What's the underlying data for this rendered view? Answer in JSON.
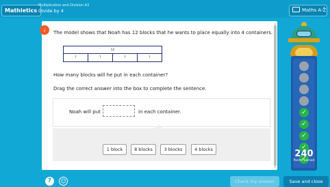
{
  "header": {
    "brand": "Mathletics",
    "crumb_line1": "Multiplication and Division A3",
    "crumb_line2": "Divide by 4",
    "atoz_label": "Maths A-Z",
    "atoz_external_icon": "external-link-icon"
  },
  "question": {
    "speaker_icon": "speaker-icon",
    "text": "The model shows that Noah has 12 blocks that he wants to place equally into 4 containers.",
    "bar_model": {
      "total": "12",
      "parts": [
        "?",
        "?",
        "?",
        "?"
      ]
    },
    "prompt": "How many blocks will he put in each container?",
    "instruction": "Drag the correct answer into the box to complete the sentence."
  },
  "sentence": {
    "before": "Noah will put",
    "after": "in each container."
  },
  "answers": [
    "1 block",
    "8 blocks",
    "3 blocks",
    "4 blocks"
  ],
  "footer": {
    "help_icon": "help-icon",
    "accessibility_icon": "accessibility-icon",
    "check_label": "Check my answer",
    "save_label": "Save and close"
  },
  "points": {
    "value": "240",
    "label": "Points earned",
    "slots_total": 9,
    "slots_completed": 5
  },
  "colors": {
    "background": "#11a8d6",
    "done": "#27b24a",
    "speaker": "#ef5b25",
    "save": "#0b7fb0"
  }
}
